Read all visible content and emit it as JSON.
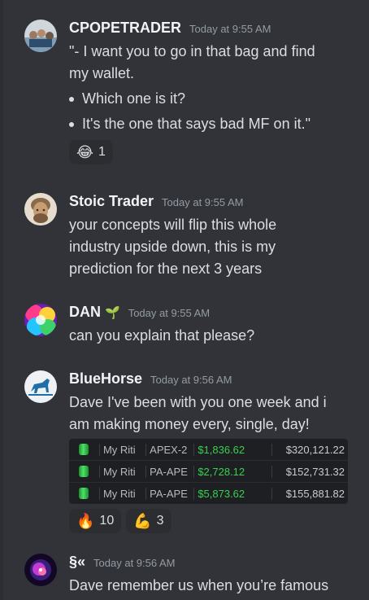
{
  "messages": [
    {
      "username": "CPOPETRADER",
      "timestamp": "Today at 9:55 AM",
      "lines": [
        "\"- I want you to go in that bag and find",
        "my wallet."
      ],
      "bullets": [
        "Which one is it?",
        "It's the one that says bad MF on it.\""
      ],
      "reactions": [
        {
          "emoji": "😂",
          "count": "1"
        }
      ]
    },
    {
      "username": "Stoic Trader",
      "timestamp": "Today at 9:55 AM",
      "lines": [
        "your concepts will flip this whole",
        "industry upside down, this is my",
        "prediction for the next 3 years"
      ]
    },
    {
      "username": "DAN",
      "badge": "🌱",
      "timestamp": "Today at 9:55 AM",
      "lines": [
        "can you explain that please?"
      ]
    },
    {
      "username": "BlueHorse",
      "timestamp": "Today at 9:56 AM",
      "lines": [
        "Dave I've been with you one week and i",
        "am making money every, single, day!"
      ],
      "attachment": {
        "rows": [
          {
            "acct": "My Riti",
            "name": "APEX-2",
            "pnl": "$1,836.62",
            "balance": "$320,121.22"
          },
          {
            "acct": "My Riti",
            "name": "PA-APE",
            "pnl": "$2,728.12",
            "balance": "$152,731.32"
          },
          {
            "acct": "My Riti",
            "name": "PA-APE",
            "pnl": "$5,873.62",
            "balance": "$155,881.82"
          }
        ]
      },
      "reactions": [
        {
          "emoji": "🔥",
          "count": "10"
        },
        {
          "emoji": "💪",
          "count": "3"
        }
      ]
    },
    {
      "username": "§«",
      "timestamp": "Today at 9:56 AM",
      "lines": [
        "Dave remember us when you’re famous"
      ]
    }
  ]
}
